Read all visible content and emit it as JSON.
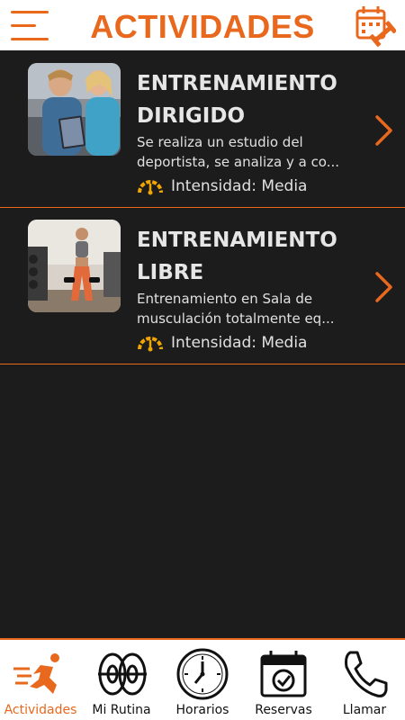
{
  "header": {
    "title": "ACTIVIDADES",
    "menu_icon": "hamburger-menu-icon",
    "calendar_icon": "calendar-dumbbell-icon",
    "accent": "#e8681d"
  },
  "activities": [
    {
      "title_line1": "ENTRENAMIENTO",
      "title_line2": "DIRIGIDO",
      "desc_line1": "Se realiza un estudio del",
      "desc_line2": "deportista, se analiza y a co...",
      "intensity": "Intensidad: Media",
      "image": "couple-with-tablet-photo"
    },
    {
      "title_line1": "ENTRENAMIENTO",
      "title_line2": "LIBRE",
      "desc_line1": "Entrenamiento en Sala de",
      "desc_line2": "musculación totalmente eq...",
      "intensity": "Intensidad: Media",
      "image": "woman-lifting-dumbbells-photo"
    }
  ],
  "tabs": [
    {
      "label": "Actividades",
      "icon": "runner-icon",
      "active": true
    },
    {
      "label": "Mi Rutina",
      "icon": "weight-plates-icon",
      "active": false
    },
    {
      "label": "Horarios",
      "icon": "clock-icon",
      "active": false
    },
    {
      "label": "Reservas",
      "icon": "calendar-check-icon",
      "active": false
    },
    {
      "label": "Llamar",
      "icon": "phone-icon",
      "active": false
    }
  ],
  "colors": {
    "background": "#1c1c1c",
    "accent": "#e8681d",
    "text": "#e6e6e6",
    "gauge": "#f0a500"
  }
}
